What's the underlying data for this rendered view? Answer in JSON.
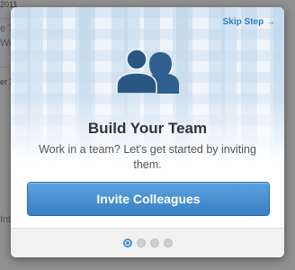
{
  "background_page": {
    "texts": [
      "2011",
      "e T",
      "Wo",
      "er 2",
      "Int"
    ]
  },
  "modal": {
    "skip_label": "Skip Step →",
    "icon": "team-icon",
    "title": "Build Your Team",
    "subtitle": "Work in a team? Let's get started by inviting them.",
    "button_label": "Invite Colleagues",
    "pagination": {
      "total": 4,
      "current": 1
    }
  },
  "colors": {
    "accent": "#3a7fc4",
    "icon": "#2f5f8e",
    "link": "#2f7fc6"
  }
}
